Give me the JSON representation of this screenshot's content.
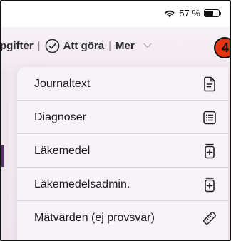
{
  "status_bar": {
    "wifi_icon": "wifi-icon",
    "battery_text": "57 %",
    "battery_level": 0.57,
    "battery_icon": "battery-icon"
  },
  "nav": {
    "tab_left_label": "pgifter",
    "tab_todo_label": "Att göra",
    "tab_more_label": "Mer",
    "separator": "|",
    "check_icon": "checkmark-circle-icon",
    "chevron_icon": "chevron-down-icon",
    "badge_text": "4"
  },
  "menu": {
    "items": [
      {
        "label": "Journaltext",
        "icon": "document-lines-icon"
      },
      {
        "label": "Diagnoser",
        "icon": "checklist-icon"
      },
      {
        "label": "Läkemedel",
        "icon": "medicine-bottle-icon"
      },
      {
        "label": "Läkemedelsadmin.",
        "icon": "medicine-bottle-icon"
      },
      {
        "label": "Mätvärden (ej provsvar)",
        "icon": "ruler-icon"
      }
    ]
  },
  "colors": {
    "accent": "#e53312",
    "text": "#1c1a1f",
    "menu_bg": "#f7f4f7"
  }
}
